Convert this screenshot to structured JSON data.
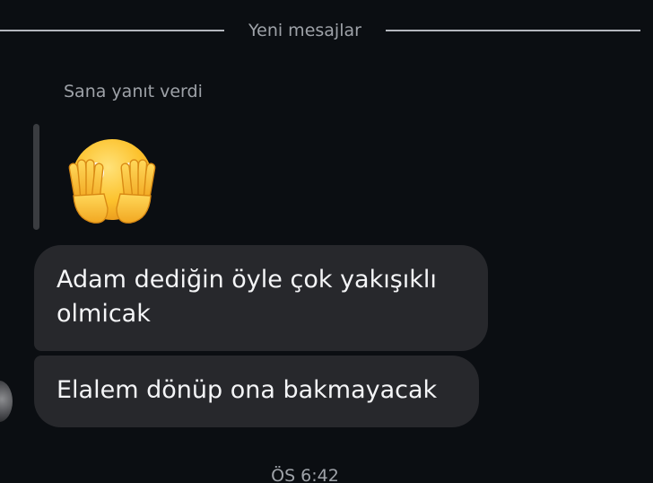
{
  "divider": {
    "label": "Yeni mesajlar"
  },
  "reply": {
    "caption": "Sana yanıt verdi",
    "emoji_icon": "face-covering-eyes-emoji"
  },
  "messages": [
    {
      "text": "Adam dediğin öyle çok yakışıklı olmicak"
    },
    {
      "text": "Elalem dönüp ona bakmayacak"
    }
  ],
  "timestamp": "ÖS 6:42",
  "colors": {
    "background": "#0b0e12",
    "bubble": "#27282c",
    "muted_text": "#9ea2a8",
    "message_text": "#f4f5f7"
  }
}
